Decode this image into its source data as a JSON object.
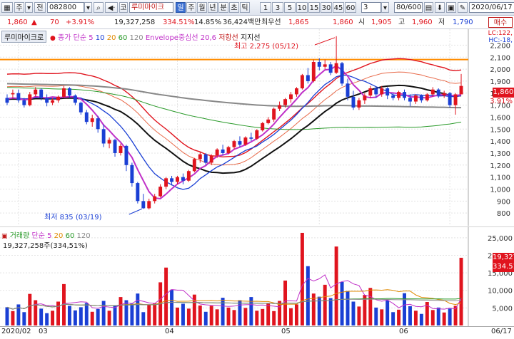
{
  "toolbar": {
    "menu_icon": "grid-menu-icon",
    "market_label": "주",
    "type_label": "전",
    "stock_code": "082800",
    "stock_name_prefix": "코",
    "stock_name": "루미마이크",
    "periods": [
      "일",
      "주",
      "월",
      "년",
      "분",
      "초",
      "틱"
    ],
    "selected_period": "일",
    "intervals": [
      "1",
      "3",
      "5",
      "10",
      "15",
      "30",
      "45",
      "60"
    ],
    "interval_value": "3",
    "count_value": "80/600",
    "date_value": "2020/06/17"
  },
  "infobar": {
    "price": "1,860",
    "change_arrow": "▲",
    "change": "70",
    "change_pct": "+3.91%",
    "volume": "19,327,258",
    "volume_ratio": "334.51%",
    "turnover": "14.85%",
    "amount": "36,424백만",
    "best_ask_label": "최우선",
    "best_ask": "1,865",
    "best_bid": "1,860",
    "open_label": "시",
    "open": "1,905",
    "high_label": "고",
    "high": "1,960",
    "low_label": "저",
    "low": "1,790",
    "trade_button": "매수"
  },
  "price_legend": {
    "name": "루미마이크로",
    "ma_label": "종가 단순",
    "ma_periods": [
      "5",
      "10",
      "20",
      "60",
      "120"
    ],
    "envelope_label": "Envelope중심선 20,6",
    "resistance_label": "저항선",
    "support_label": "지지선",
    "lc_label": "LC:122,",
    "hc_label": "HC:-18,"
  },
  "price_annotations": {
    "high_note": "최고 2,275 (05/12)",
    "low_note": "최저 835 (03/19)",
    "current_badge": "1,860",
    "current_pct": "3.91%"
  },
  "volume_legend": {
    "name": "거래량",
    "ma_label": "단순",
    "ma_periods": [
      "5",
      "20",
      "60",
      "120"
    ],
    "value_text": "19,327,258주(334,51%)",
    "badge_volume": "19,327",
    "badge_pct": "334.51"
  },
  "date_axis": {
    "labels": [
      "2020/02",
      "03",
      "04",
      "05",
      "06",
      "06/17"
    ]
  },
  "colors": {
    "up": "#e0141e",
    "down": "#1a3fd4",
    "ma5": "#c030c8",
    "ma10": "#1a3fd4",
    "ma20": "#e08a00",
    "ma60": "#2a9a2a",
    "ma120": "#888888",
    "resistance": "#ff8c00"
  },
  "chart_data": [
    {
      "type": "candlestick",
      "title": "루미마이크로",
      "ylim": [
        700,
        2250
      ],
      "y_ticks": [
        800,
        900,
        1000,
        1100,
        1200,
        1300,
        1400,
        1500,
        1600,
        1700,
        1800,
        1900,
        2000,
        2100,
        2200
      ],
      "x_labels": [
        "2020/02",
        "03",
        "04",
        "05",
        "06",
        "06/17"
      ],
      "resistance": 2080,
      "high": {
        "value": 2275,
        "date": "05/12"
      },
      "low": {
        "value": 835,
        "date": "03/19"
      },
      "candles": [
        [
          1760,
          1790,
          1720,
          1700
        ],
        [
          1790,
          1830,
          1800,
          1760
        ],
        [
          1800,
          1830,
          1740,
          1720
        ],
        [
          1740,
          1760,
          1700,
          1680
        ],
        [
          1700,
          1810,
          1790,
          1690
        ],
        [
          1790,
          1850,
          1830,
          1770
        ],
        [
          1830,
          1840,
          1760,
          1740
        ],
        [
          1760,
          1790,
          1720,
          1690
        ],
        [
          1720,
          1760,
          1740,
          1700
        ],
        [
          1740,
          1780,
          1770,
          1720
        ],
        [
          1770,
          1860,
          1840,
          1760
        ],
        [
          1840,
          1850,
          1780,
          1760
        ],
        [
          1780,
          1790,
          1720,
          1700
        ],
        [
          1720,
          1730,
          1640,
          1620
        ],
        [
          1640,
          1660,
          1560,
          1540
        ],
        [
          1560,
          1620,
          1590,
          1520
        ],
        [
          1590,
          1610,
          1500,
          1470
        ],
        [
          1500,
          1540,
          1380,
          1350
        ],
        [
          1380,
          1430,
          1410,
          1340
        ],
        [
          1410,
          1420,
          1300,
          1270
        ],
        [
          1300,
          1380,
          1360,
          1280
        ],
        [
          1360,
          1370,
          1200,
          1150
        ],
        [
          1200,
          1220,
          1050,
          1020
        ],
        [
          1050,
          1060,
          900,
          880
        ],
        [
          900,
          960,
          840,
          835
        ],
        [
          840,
          920,
          900,
          830
        ],
        [
          900,
          960,
          940,
          880
        ],
        [
          940,
          1040,
          1020,
          930
        ],
        [
          1020,
          1100,
          1090,
          1000
        ],
        [
          1090,
          1110,
          1060,
          1030
        ],
        [
          1060,
          1110,
          1100,
          1040
        ],
        [
          1100,
          1130,
          1070,
          1040
        ],
        [
          1070,
          1160,
          1150,
          1060
        ],
        [
          1150,
          1260,
          1250,
          1140
        ],
        [
          1250,
          1310,
          1290,
          1220
        ],
        [
          1290,
          1300,
          1220,
          1200
        ],
        [
          1220,
          1290,
          1280,
          1200
        ],
        [
          1280,
          1340,
          1330,
          1260
        ],
        [
          1330,
          1370,
          1300,
          1280
        ],
        [
          1300,
          1360,
          1350,
          1290
        ],
        [
          1350,
          1410,
          1400,
          1330
        ],
        [
          1400,
          1440,
          1370,
          1350
        ],
        [
          1370,
          1440,
          1430,
          1360
        ],
        [
          1430,
          1470,
          1420,
          1400
        ],
        [
          1420,
          1500,
          1490,
          1410
        ],
        [
          1490,
          1560,
          1550,
          1480
        ],
        [
          1550,
          1600,
          1580,
          1540
        ],
        [
          1580,
          1680,
          1670,
          1560
        ],
        [
          1670,
          1730,
          1700,
          1650
        ],
        [
          1700,
          1760,
          1750,
          1680
        ],
        [
          1750,
          1810,
          1790,
          1720
        ],
        [
          1790,
          1850,
          1840,
          1770
        ],
        [
          1840,
          1960,
          1950,
          1830
        ],
        [
          1950,
          2010,
          1900,
          1880
        ],
        [
          1900,
          2080,
          2060,
          1890
        ],
        [
          2060,
          2090,
          2020,
          1990
        ],
        [
          2020,
          2080,
          2040,
          2000
        ],
        [
          2040,
          2060,
          1970,
          1950
        ],
        [
          1970,
          2275,
          2050,
          1960
        ],
        [
          2050,
          2060,
          1880,
          1860
        ],
        [
          1880,
          1920,
          1770,
          1740
        ],
        [
          1770,
          1820,
          1680,
          1660
        ],
        [
          1680,
          1760,
          1740,
          1660
        ],
        [
          1740,
          1800,
          1780,
          1710
        ],
        [
          1780,
          1860,
          1840,
          1760
        ],
        [
          1840,
          1850,
          1790,
          1760
        ],
        [
          1790,
          1860,
          1840,
          1770
        ],
        [
          1840,
          1850,
          1780,
          1750
        ],
        [
          1780,
          1800,
          1760,
          1740
        ],
        [
          1760,
          1820,
          1810,
          1740
        ],
        [
          1810,
          1830,
          1760,
          1740
        ],
        [
          1760,
          1790,
          1730,
          1690
        ],
        [
          1730,
          1790,
          1780,
          1710
        ],
        [
          1780,
          1790,
          1740,
          1720
        ],
        [
          1740,
          1800,
          1790,
          1730
        ],
        [
          1790,
          1850,
          1830,
          1770
        ],
        [
          1830,
          1840,
          1780,
          1760
        ],
        [
          1780,
          1820,
          1800,
          1760
        ],
        [
          1800,
          1810,
          1700,
          1680
        ],
        [
          1700,
          1800,
          1790,
          1620
        ],
        [
          1790,
          1960,
          1860,
          1790
        ]
      ]
    },
    {
      "type": "bar",
      "title": "거래량",
      "ylim": [
        0,
        27000
      ],
      "y_ticks": [
        5000,
        10000,
        15000,
        20000,
        25000
      ],
      "volumes": [
        5200,
        4100,
        6000,
        3800,
        9000,
        7200,
        4800,
        3500,
        4200,
        6800,
        11800,
        5600,
        4300,
        5200,
        6400,
        3900,
        4700,
        7000,
        4200,
        5600,
        8100,
        7200,
        6200,
        9100,
        3800,
        5900,
        6300,
        12300,
        16500,
        10200,
        5100,
        6200,
        4800,
        8800,
        5700,
        3900,
        5600,
        4600,
        7900,
        5100,
        4400,
        7200,
        5000,
        8100,
        4200,
        4700,
        6400,
        4100,
        7000,
        12800,
        4900,
        6000,
        26400,
        16900,
        9100,
        8200,
        11600,
        7800,
        22500,
        12400,
        9800,
        6800,
        5400,
        8700,
        10700,
        5100,
        4600,
        7200,
        3800,
        4500,
        9200,
        5500,
        4200,
        3300,
        6700,
        4400,
        5100,
        3700,
        4800,
        5600,
        19300
      ]
    }
  ]
}
